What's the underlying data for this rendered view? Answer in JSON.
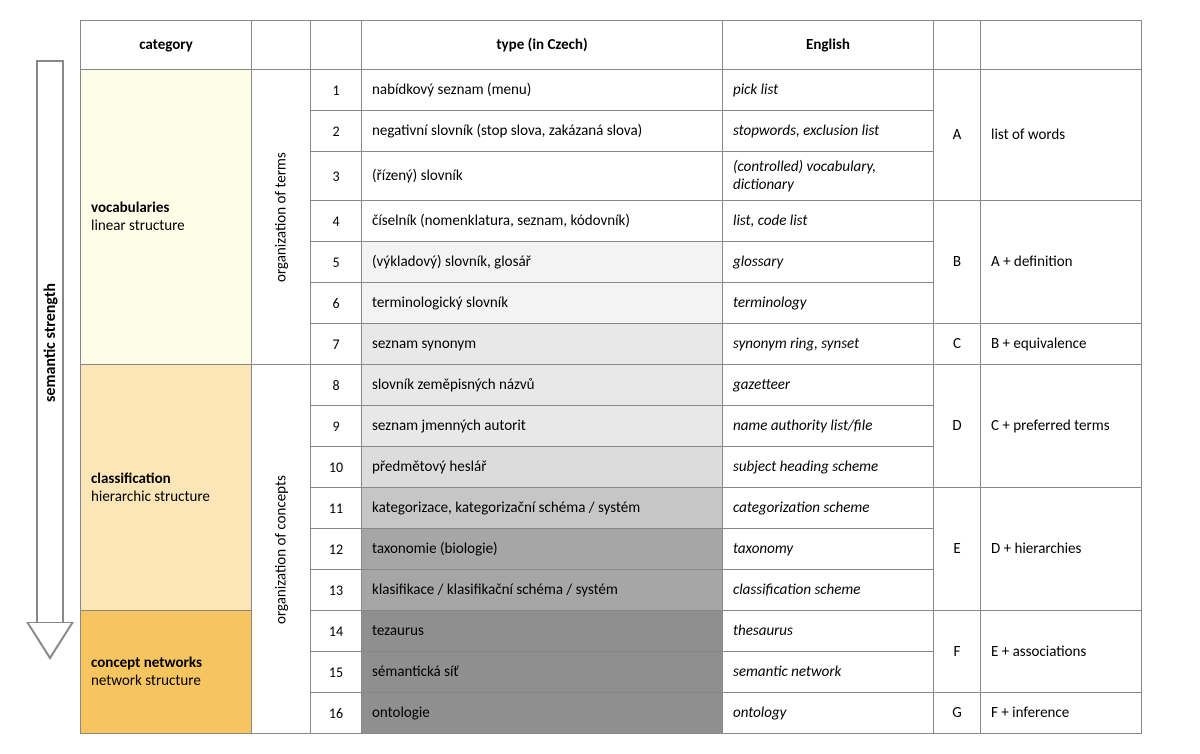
{
  "arrow_label": "semantic strength",
  "headers": {
    "category": "category",
    "type": "type (in Czech)",
    "english": "English"
  },
  "categories": {
    "voc": {
      "title": "vocabularies",
      "sub": "linear structure"
    },
    "class": {
      "title": "classification",
      "sub": "hierarchic structure"
    },
    "net": {
      "title": "concept networks",
      "sub": "network structure"
    }
  },
  "org": {
    "terms": "organization of terms",
    "concepts": "organization of concepts"
  },
  "rows": [
    {
      "n": "1",
      "cz": "nabídkový seznam (menu)",
      "en": "pick list"
    },
    {
      "n": "2",
      "cz": "negativní slovník (stop slova, zakázaná slova)",
      "en": "stopwords, exclusion list"
    },
    {
      "n": "3",
      "cz": "(řízený) slovník",
      "en": "(controlled) vocabulary, dictionary"
    },
    {
      "n": "4",
      "cz": "číselník (nomenklatura, seznam, kódovník)",
      "en": "list, code list"
    },
    {
      "n": "5",
      "cz": "(výkladový) slovník, glosář",
      "en": "glossary"
    },
    {
      "n": "6",
      "cz": "terminologický slovník",
      "en": "terminology"
    },
    {
      "n": "7",
      "cz": "seznam synonym",
      "en": "synonym ring, synset"
    },
    {
      "n": "8",
      "cz": "slovník zeměpisných názvů",
      "en": "gazetteer"
    },
    {
      "n": "9",
      "cz": "seznam jmenných autorit",
      "en": "name authority list/file"
    },
    {
      "n": "10",
      "cz": "předmětový heslář",
      "en": "subject heading scheme"
    },
    {
      "n": "11",
      "cz": "kategorizace, kategorizační schéma / systém",
      "en": "categorization scheme"
    },
    {
      "n": "12",
      "cz": "taxonomie (biologie)",
      "en": "taxonomy"
    },
    {
      "n": "13",
      "cz": "klasifikace / klasifikační schéma / systém",
      "en": "classification scheme"
    },
    {
      "n": "14",
      "cz": "tezaurus",
      "en": "thesaurus"
    },
    {
      "n": "15",
      "cz": "sémantická síť",
      "en": "semantic network"
    },
    {
      "n": "16",
      "cz": "ontologie",
      "en": "ontology"
    }
  ],
  "groups": {
    "A": {
      "letter": "A",
      "def": "list of words"
    },
    "B": {
      "letter": "B",
      "def": "A + definition"
    },
    "C": {
      "letter": "C",
      "def": "B + equivalence"
    },
    "D": {
      "letter": "D",
      "def": "C + preferred terms"
    },
    "E": {
      "letter": "E",
      "def": "D + hierarchies"
    },
    "F": {
      "letter": "F",
      "def": "E + associations"
    },
    "G": {
      "letter": "G",
      "def": "F + inference"
    }
  }
}
